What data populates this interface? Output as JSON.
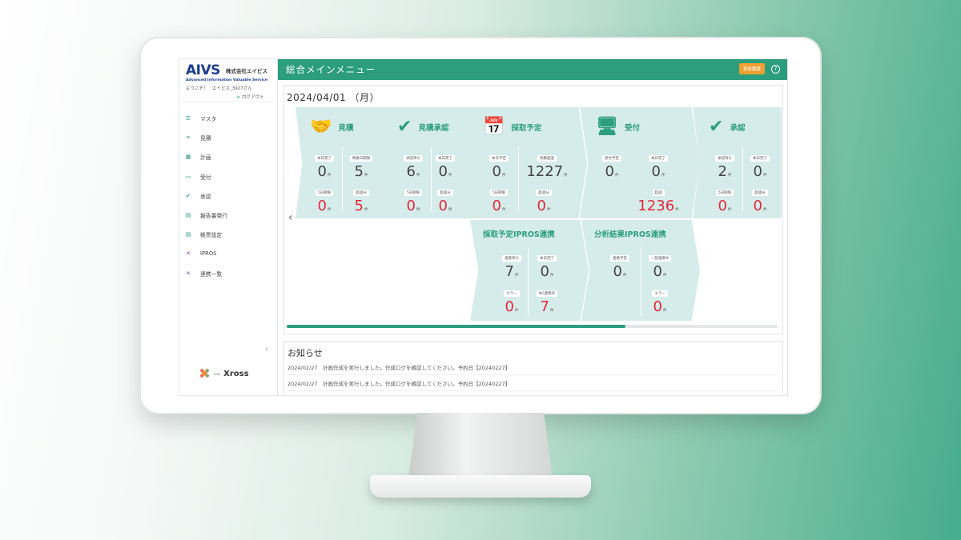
{
  "brand": {
    "logo_mark": "AIVS",
    "company": "株式会社エイビス",
    "subtitle": "Advanced Information Valuable Service",
    "welcome": "ようこそ！　エイビス_3927さん",
    "logout": "ログアウト",
    "footer_logo": "Xross",
    "footer_prefix": "aivs"
  },
  "sidebar": {
    "items": [
      {
        "label": "マスタ",
        "icon": "list-icon"
      },
      {
        "label": "見積",
        "icon": "handshake-icon"
      },
      {
        "label": "計画",
        "icon": "calendar-icon"
      },
      {
        "label": "受付",
        "icon": "monitor-icon"
      },
      {
        "label": "承認",
        "icon": "check-icon"
      },
      {
        "label": "報告書発行",
        "icon": "document-icon"
      },
      {
        "label": "帳票設定",
        "icon": "document-icon"
      },
      {
        "label": "IPROS",
        "icon": "xross-icon"
      },
      {
        "label": "連携一覧",
        "icon": "xross-icon"
      }
    ]
  },
  "header": {
    "title": "総合メインメニュー",
    "refresh_label": "更新履歴",
    "help": "?"
  },
  "date": "2024/04/01 （月）",
  "cards": {
    "estimate": {
      "title": "見積",
      "stats": [
        {
          "label": "本日完了",
          "value": "0",
          "unit": "件"
        },
        {
          "label": "明後日期限",
          "value": "5",
          "unit": "件"
        },
        {
          "label": "5日期限",
          "value": "0",
          "unit": "件"
        },
        {
          "label": "超過分",
          "value": "5",
          "unit": "件"
        }
      ]
    },
    "estimate_approval": {
      "title": "見積承認",
      "stats": [
        {
          "label": "承認待ち",
          "value": "6",
          "unit": "件"
        },
        {
          "label": "本日完了",
          "value": "0",
          "unit": "件"
        },
        {
          "label": "5日期限",
          "value": "0",
          "unit": "件"
        },
        {
          "label": "超過分",
          "value": "0",
          "unit": "件"
        }
      ]
    },
    "sampling": {
      "title": "採取予定",
      "stats": [
        {
          "label": "本日予定",
          "value": "0",
          "unit": "件"
        },
        {
          "label": "残数超過",
          "value": "1227",
          "unit": "件"
        },
        {
          "label": "5日期限",
          "value": "0",
          "unit": "件"
        },
        {
          "label": "超過分",
          "value": "0",
          "unit": "件"
        }
      ]
    },
    "reception": {
      "title": "受付",
      "stats": [
        {
          "label": "受付予定",
          "value": "0",
          "unit": "件"
        },
        {
          "label": "本日完了",
          "value": "0",
          "unit": "件"
        },
        {
          "label": "超過",
          "value": "1236",
          "unit": "件"
        }
      ]
    },
    "approval": {
      "title": "承認",
      "stats": [
        {
          "label": "承認待ち",
          "value": "2",
          "unit": "件"
        },
        {
          "label": "本日完了",
          "value": "0",
          "unit": "件"
        },
        {
          "label": "5日期限",
          "value": "0",
          "unit": "件"
        },
        {
          "label": "超過分",
          "value": "0",
          "unit": "件"
        }
      ]
    },
    "sampling_ipros": {
      "title": "採取予定IPROS連携",
      "stats": [
        {
          "label": "連携待ち",
          "value": "7",
          "unit": "件"
        },
        {
          "label": "本日完了",
          "value": "0",
          "unit": "件"
        },
        {
          "label": "エラー",
          "value": "0",
          "unit": "件"
        },
        {
          "label": "NG連携有",
          "value": "7",
          "unit": "件"
        }
      ]
    },
    "analysis_ipros": {
      "title": "分析結果IPROS連携",
      "stats": [
        {
          "label": "連携予定",
          "value": "0",
          "unit": "件"
        },
        {
          "label": "一部連携中",
          "value": "0",
          "unit": "件"
        },
        {
          "label": "エラー",
          "value": "0",
          "unit": "件"
        }
      ]
    }
  },
  "carousel_progress": 0.69,
  "notices": {
    "title": "お知らせ",
    "items": [
      "2024/02/27　計画作成を実行しました。作成ログを確認してください。予約日【20240227】",
      "2024/02/27　計画作成を実行しました。作成ログを確認してください。予約日【20240227】"
    ]
  },
  "colors": {
    "primary": "#2c9e7e",
    "card_bg": "#d6ecea",
    "alert": "#e0283c",
    "button": "#f0a030"
  }
}
